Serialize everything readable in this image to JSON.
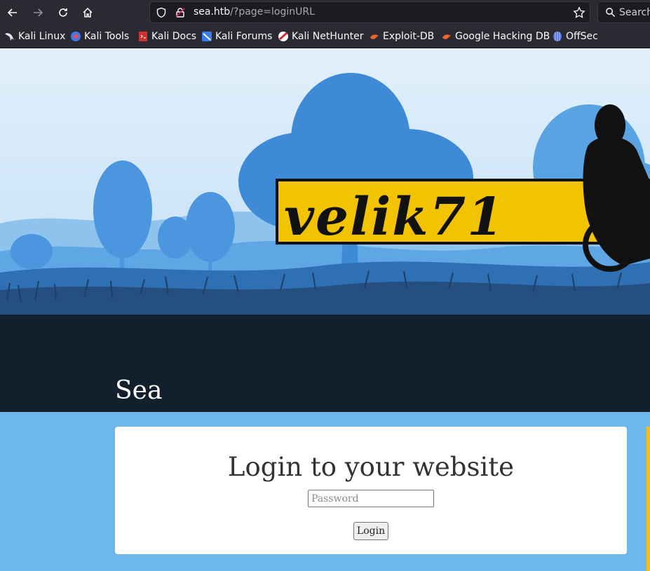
{
  "browser": {
    "url_host": "sea.htb",
    "url_path": "/?page=loginURL",
    "search_placeholder": "Search",
    "bookmarks": [
      {
        "label": "Kali Linux",
        "icon": "kali-dragon-icon"
      },
      {
        "label": "Kali Tools",
        "icon": "kali-tools-icon"
      },
      {
        "label": "Kali Docs",
        "icon": "kali-docs-icon"
      },
      {
        "label": "Kali Forums",
        "icon": "kali-forums-icon"
      },
      {
        "label": "Kali NetHunter",
        "icon": "kali-nethunter-icon"
      },
      {
        "label": "Exploit-DB",
        "icon": "exploit-db-icon"
      },
      {
        "label": "Google Hacking DB",
        "icon": "ghdb-icon"
      },
      {
        "label": "OffSec",
        "icon": "offsec-icon"
      }
    ]
  },
  "site": {
    "banner_text": "velik71",
    "title": "Sea"
  },
  "login": {
    "heading": "Login to your website",
    "password_placeholder": "Password",
    "button_label": "Login"
  },
  "colors": {
    "banner_yellow": "#f2c300",
    "sky": "#d8ecfa",
    "page_bg": "#6eb6ee",
    "hero_dark": "#12202e"
  }
}
